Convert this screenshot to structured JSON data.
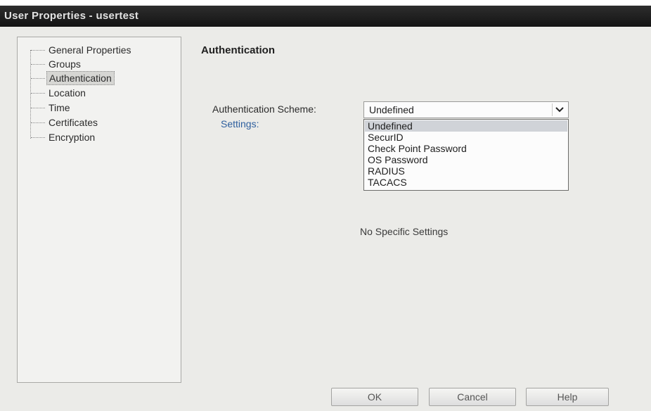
{
  "window": {
    "title": "User Properties - usertest"
  },
  "sidebar": {
    "items": [
      {
        "label": "General Properties",
        "selected": false
      },
      {
        "label": "Groups",
        "selected": false
      },
      {
        "label": "Authentication",
        "selected": true
      },
      {
        "label": "Location",
        "selected": false
      },
      {
        "label": "Time",
        "selected": false
      },
      {
        "label": "Certificates",
        "selected": false
      },
      {
        "label": "Encryption",
        "selected": false
      }
    ]
  },
  "main": {
    "section_title": "Authentication",
    "scheme_label": "Authentication Scheme:",
    "settings_link": "Settings:",
    "scheme_select": {
      "value": "Undefined",
      "icon": "chevron-down-icon",
      "options": [
        "Undefined",
        "SecurID",
        "Check Point Password",
        "OS Password",
        "RADIUS",
        "TACACS"
      ],
      "highlighted": "Undefined"
    },
    "no_settings_text": "No Specific Settings"
  },
  "buttons": {
    "ok": "OK",
    "cancel": "Cancel",
    "help": "Help"
  }
}
